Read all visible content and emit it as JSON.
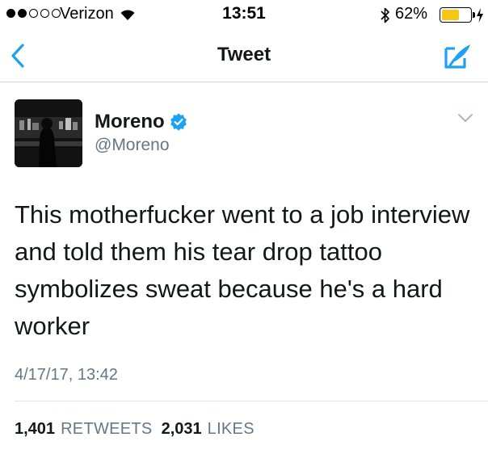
{
  "status_bar": {
    "carrier": "Verizon",
    "time": "13:51",
    "battery_percent": "62%",
    "battery_level": 0.62,
    "signal_bars_filled": 2,
    "signal_bars_total": 5,
    "battery_color": "#f5c518"
  },
  "nav": {
    "title": "Tweet",
    "back_icon": "chevron-left-icon",
    "compose_icon": "compose-tweet-icon",
    "accent_color": "#1da1f2"
  },
  "tweet": {
    "author": {
      "name": "Moreno",
      "handle": "@Moreno",
      "verified": true
    },
    "text": "This motherfucker went to a job interview and told them his tear drop tattoo symbolizes sweat because he's a hard worker",
    "timestamp": "4/17/17, 13:42",
    "retweets": {
      "count": "1,401",
      "label": "RETWEETS"
    },
    "likes": {
      "count": "2,031",
      "label": "LIKES"
    }
  }
}
